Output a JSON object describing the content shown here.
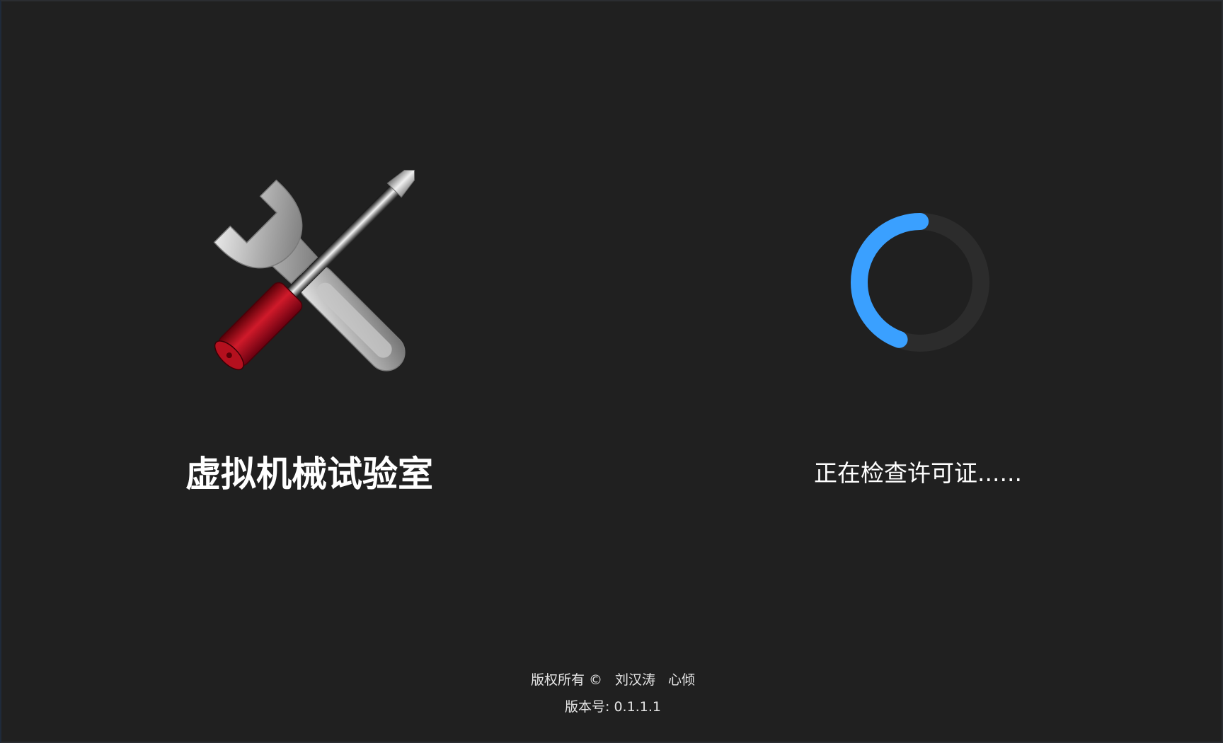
{
  "app": {
    "title": "虚拟机械试验室",
    "logo_icon": "wrench-screwdriver-icon"
  },
  "status": {
    "text": "正在检查许可证......",
    "spinner_icon": "loading-spinner-icon",
    "spinner_color": "#3aa0ff",
    "track_color": "#2c2c2c"
  },
  "footer": {
    "copyright_label": "版权所有 ©",
    "author_1": "刘汉涛",
    "author_2": "心倾",
    "version_text": "版本号: 0.1.1.1"
  },
  "colors": {
    "background": "#202020",
    "accent": "#3aa0ff"
  }
}
